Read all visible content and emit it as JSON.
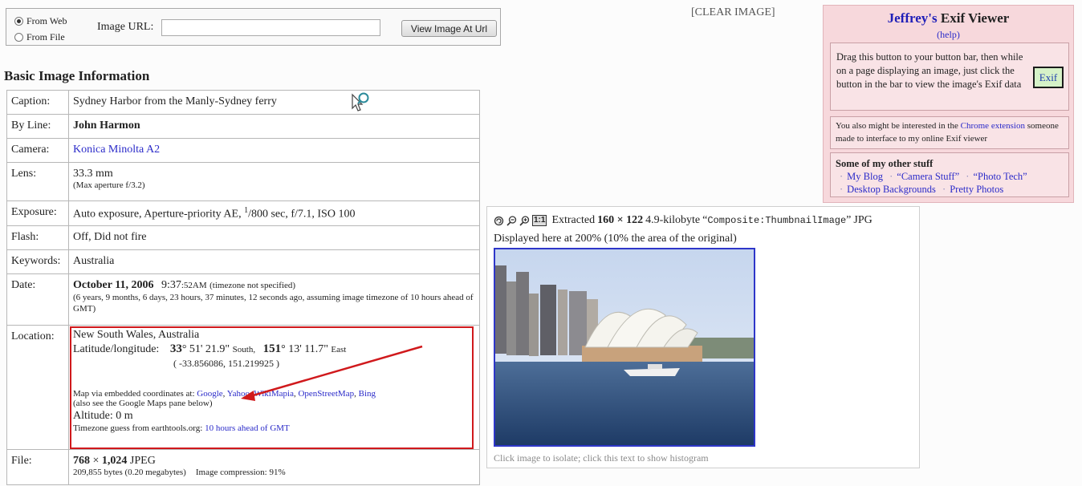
{
  "form": {
    "source_options": [
      {
        "label": "From Web",
        "selected": true
      },
      {
        "label": "From File",
        "selected": false
      }
    ],
    "url_label": "Image URL:",
    "url_value": "",
    "submit_label": "View Image At Url"
  },
  "clear_link": "[CLEAR IMAGE]",
  "section_title": "Basic Image Information",
  "info": {
    "caption": {
      "label": "Caption:",
      "value": "Sydney Harbor from the Manly-Sydney ferry"
    },
    "byline": {
      "label": "By Line:",
      "value": "John Harmon"
    },
    "camera": {
      "label": "Camera:",
      "value": "Konica Minolta A2"
    },
    "lens": {
      "label": "Lens:",
      "value": "33.3 mm",
      "note": "(Max aperture f/3.2)"
    },
    "exposure": {
      "label": "Exposure:",
      "pre": "Auto exposure, Aperture-priority AE, ",
      "sup": "1",
      "post": "/800 sec, f/7.1, ISO 100"
    },
    "flash": {
      "label": "Flash:",
      "value": "Off, Did not fire"
    },
    "keywords": {
      "label": "Keywords:",
      "value": "Australia"
    },
    "date": {
      "label": "Date:",
      "date": "October 11, 2006",
      "time_hm": "9:37",
      "time_rest": ":52AM",
      "tz_note": "(timezone not specified)",
      "ago": "(6 years, 9 months, 6 days, 23 hours, 37 minutes, 12 seconds ago, assuming image timezone of 10 hours ahead of GMT)"
    },
    "location": {
      "label": "Location:",
      "place": "New South Wales, Australia",
      "latlon_label": "Latitude/longitude:",
      "lat_deg": "33",
      "lat_rest": "° 51' 21.9\"",
      "lat_dir": "South,",
      "lon_deg": "151",
      "lon_rest": "° 13' 11.7\"",
      "lon_dir": "East",
      "decimal": "( -33.856086, 151.219925 )",
      "map_label": "Map via embedded coordinates at:",
      "map_links": [
        "Google",
        "Yahoo",
        "WikiMapia",
        "OpenStreetMap",
        "Bing"
      ],
      "map_note": "(also see the Google Maps pane below)",
      "altitude": "Altitude: 0 m",
      "tz_label": "Timezone guess from earthtools.org:",
      "tz_link": "10 hours ahead of GMT"
    },
    "file": {
      "label": "File:",
      "w": "768",
      "x": "×",
      "h": "1,024",
      "format": "JPEG",
      "bytes": "209,855 bytes (0.20 megabytes)",
      "compression": "Image compression: 91%"
    }
  },
  "exif_panel": {
    "title_owner": "Jeffrey's",
    "title_rest": "Exif Viewer",
    "help": "(help)",
    "drag_text": "Drag this button to your button bar, then while on a page displaying an image, just click the button in the bar to view the image's Exif data",
    "button_label": "Exif",
    "ext_pre": "You also might be interested in the",
    "ext_link": "Chrome extension",
    "ext_post": "someone made to interface to my online Exif viewer",
    "other_title": "Some of my other stuff",
    "other_links": [
      "My Blog",
      "“Camera Stuff”",
      "“Photo Tech”",
      "Desktop Backgrounds",
      "Pretty Photos"
    ]
  },
  "thumb": {
    "zoom_label": "1:1",
    "extracted": "Extracted",
    "dims": "160 × 122",
    "size": "4.9-kilobyte",
    "tag": "Composite:ThumbnailImage",
    "format": "JPG",
    "displayed": "Displayed here at 200% (10% the area of the original)",
    "caption": "Click image to isolate; click this text to show histogram"
  },
  "colors": {
    "link": "#2b2bc9",
    "highlight": "#d0191c",
    "panel_bg": "#f7d8dc"
  },
  "icons": [
    "search-cursor-icon",
    "rotate-icon",
    "zoom-out-icon",
    "zoom-in-icon",
    "arrow-annotation"
  ]
}
